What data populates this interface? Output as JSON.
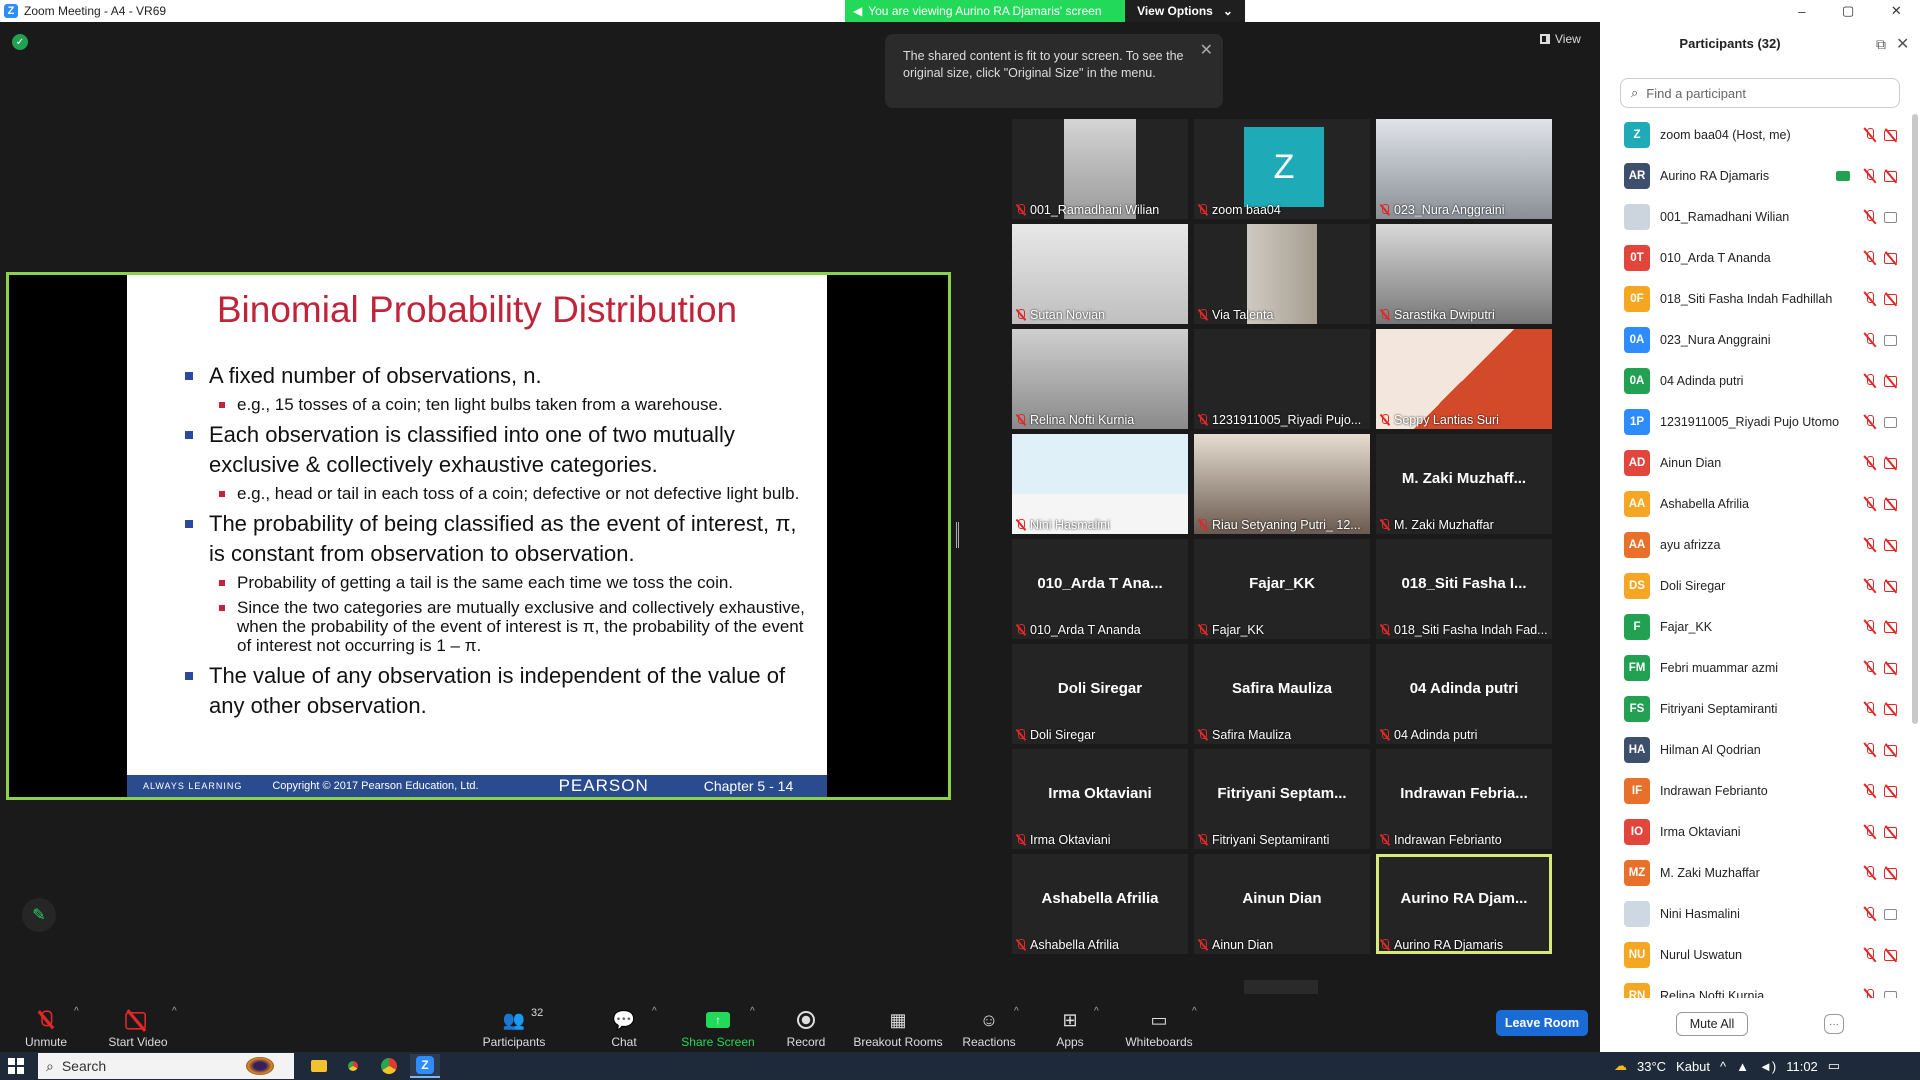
{
  "window": {
    "title": "Zoom Meeting - A4 - VR69",
    "viewing_banner": "You are viewing Aurino RA Djamaris' screen",
    "view_options": "View Options",
    "controls": [
      "–",
      "▢",
      "✕"
    ]
  },
  "stage": {
    "tooltip": "The shared content is fit to your screen. To see the original size, click \"Original Size\" in the menu.",
    "view_label": "View"
  },
  "slide": {
    "title": "Binomial Probability Distribution",
    "bullets": [
      {
        "text": "A fixed number of observations, n.",
        "sub": [
          "e.g., 15 tosses of a coin; ten light bulbs taken from a warehouse."
        ]
      },
      {
        "text": "Each observation is classified into one of two mutually exclusive & collectively exhaustive categories.",
        "sub": [
          "e.g., head or tail in each toss of a coin; defective or not defective light bulb."
        ]
      },
      {
        "text": "The probability of being classified as the event of interest, π, is constant from observation to observation.",
        "sub": [
          "Probability of getting a tail is the same each time we toss the coin.",
          "Since the two categories are mutually exclusive and collectively exhaustive, when the probability of the event of interest is π, the probability of the event of interest not occurring is 1 – π."
        ]
      },
      {
        "text": "The value of any observation is independent of the value of any other observation.",
        "sub": []
      }
    ],
    "footer": {
      "always": "ALWAYS LEARNING",
      "copyright": "Copyright © 2017 Pearson Education, Ltd.",
      "pearson": "PEARSON",
      "chapter": "Chapter 5 - 14"
    }
  },
  "tiles": [
    {
      "label": "001_Ramadhani Wilian",
      "type": "video"
    },
    {
      "label": "zoom baa04",
      "type": "avatar",
      "letter": "Z"
    },
    {
      "label": "023_Nura Anggraini",
      "type": "video"
    },
    {
      "label": "Sutan Novian",
      "type": "video"
    },
    {
      "label": "Via Talenta",
      "type": "video"
    },
    {
      "label": "Sarastika Dwiputri",
      "type": "video"
    },
    {
      "label": "Relina Nofti Kurnia",
      "type": "video"
    },
    {
      "label": "1231911005_Riyadi Pujo...",
      "type": "blank"
    },
    {
      "label": "Seppy Lantias Suri",
      "type": "video"
    },
    {
      "label": "Nini Hasmalini",
      "type": "video"
    },
    {
      "label": "Riau Setyaning Putri_ 12...",
      "type": "video"
    },
    {
      "label": "M. Zaki Muzhaffar",
      "type": "name",
      "name": "M. Zaki Muzhaff..."
    },
    {
      "label": "010_Arda T Ananda",
      "type": "name",
      "name": "010_Arda T Ana..."
    },
    {
      "label": "Fajar_KK",
      "type": "name",
      "name": "Fajar_KK"
    },
    {
      "label": "018_Siti Fasha Indah Fad...",
      "type": "name",
      "name": "018_Siti Fasha I..."
    },
    {
      "label": "Doli Siregar",
      "type": "name",
      "name": "Doli Siregar"
    },
    {
      "label": "Safira Mauliza",
      "type": "name",
      "name": "Safira Mauliza"
    },
    {
      "label": "04 Adinda putri",
      "type": "name",
      "name": "04 Adinda putri"
    },
    {
      "label": "Irma Oktaviani",
      "type": "name",
      "name": "Irma Oktaviani"
    },
    {
      "label": "Fitriyani Septamiranti",
      "type": "name",
      "name": "Fitriyani Septam..."
    },
    {
      "label": "Indrawan Febrianto",
      "type": "name",
      "name": "Indrawan Febria..."
    },
    {
      "label": "Ashabella Afrilia",
      "type": "name",
      "name": "Ashabella Afrilia"
    },
    {
      "label": "Ainun Dian",
      "type": "name",
      "name": "Ainun Dian"
    },
    {
      "label": "Aurino RA Djamaris",
      "type": "name",
      "name": "Aurino RA Djam...",
      "active": true
    }
  ],
  "panel": {
    "title": "Participants (32)",
    "search_placeholder": "Find a participant",
    "mute_all": "Mute All",
    "more": "···",
    "participants": [
      {
        "initials": "Z",
        "name": "zoom baa04 (Host, me)",
        "color": "#1faab8",
        "cam": "off"
      },
      {
        "initials": "AR",
        "name": "Aurino RA Djamaris",
        "color": "#3d4f6b",
        "cam": "off",
        "sharing": true
      },
      {
        "initials": "",
        "name": "001_Ramadhani Wilian",
        "color": "#ccd4dd",
        "cam": "on",
        "photo": true
      },
      {
        "initials": "0T",
        "name": "010_Arda T Ananda",
        "color": "#e2453c",
        "cam": "off"
      },
      {
        "initials": "0F",
        "name": "018_Siti Fasha Indah Fadhillah",
        "color": "#f5a623",
        "cam": "off"
      },
      {
        "initials": "0A",
        "name": "023_Nura Anggraini",
        "color": "#2d8cff",
        "cam": "on"
      },
      {
        "initials": "0A",
        "name": "04 Adinda putri",
        "color": "#23a152",
        "cam": "off"
      },
      {
        "initials": "1P",
        "name": "1231911005_Riyadi Pujo Utomo",
        "color": "#2d8cff",
        "cam": "on"
      },
      {
        "initials": "AD",
        "name": "Ainun Dian",
        "color": "#e2453c",
        "cam": "off"
      },
      {
        "initials": "AA",
        "name": "Ashabella Afrilia",
        "color": "#f5a623",
        "cam": "off"
      },
      {
        "initials": "AA",
        "name": "ayu afrizza",
        "color": "#e8702a",
        "cam": "off"
      },
      {
        "initials": "DS",
        "name": "Doli Siregar",
        "color": "#f5a623",
        "cam": "off"
      },
      {
        "initials": "F",
        "name": "Fajar_KK",
        "color": "#23a152",
        "cam": "off"
      },
      {
        "initials": "FM",
        "name": "Febri muammar azmi",
        "color": "#23a152",
        "cam": "off"
      },
      {
        "initials": "FS",
        "name": "Fitriyani Septamiranti",
        "color": "#23a152",
        "cam": "off"
      },
      {
        "initials": "HA",
        "name": "Hilman Al Qodrian",
        "color": "#3d4f6b",
        "cam": "off"
      },
      {
        "initials": "IF",
        "name": "Indrawan Febrianto",
        "color": "#e8702a",
        "cam": "off"
      },
      {
        "initials": "IO",
        "name": "Irma Oktaviani",
        "color": "#e2453c",
        "cam": "off"
      },
      {
        "initials": "MZ",
        "name": "M. Zaki Muzhaffar",
        "color": "#e8702a",
        "cam": "off"
      },
      {
        "initials": "",
        "name": "Nini Hasmalini",
        "color": "#cdd8e3",
        "cam": "on",
        "photo": true
      },
      {
        "initials": "NU",
        "name": "Nurul Uswatun",
        "color": "#f5a623",
        "cam": "off"
      },
      {
        "initials": "RN",
        "name": "Relina Nofti Kurnia",
        "color": "#f5a623",
        "cam": "on"
      }
    ]
  },
  "toolbar": {
    "unmute": "Unmute",
    "start_video": "Start Video",
    "participants": "Participants",
    "participants_count": "32",
    "chat": "Chat",
    "share_screen": "Share Screen",
    "record": "Record",
    "breakout": "Breakout Rooms",
    "reactions": "Reactions",
    "apps": "Apps",
    "whiteboards": "Whiteboards",
    "leave": "Leave Room"
  },
  "taskbar": {
    "search": "Search",
    "weather": "33°C",
    "weather_desc": "Kabut",
    "time": "11:02"
  }
}
